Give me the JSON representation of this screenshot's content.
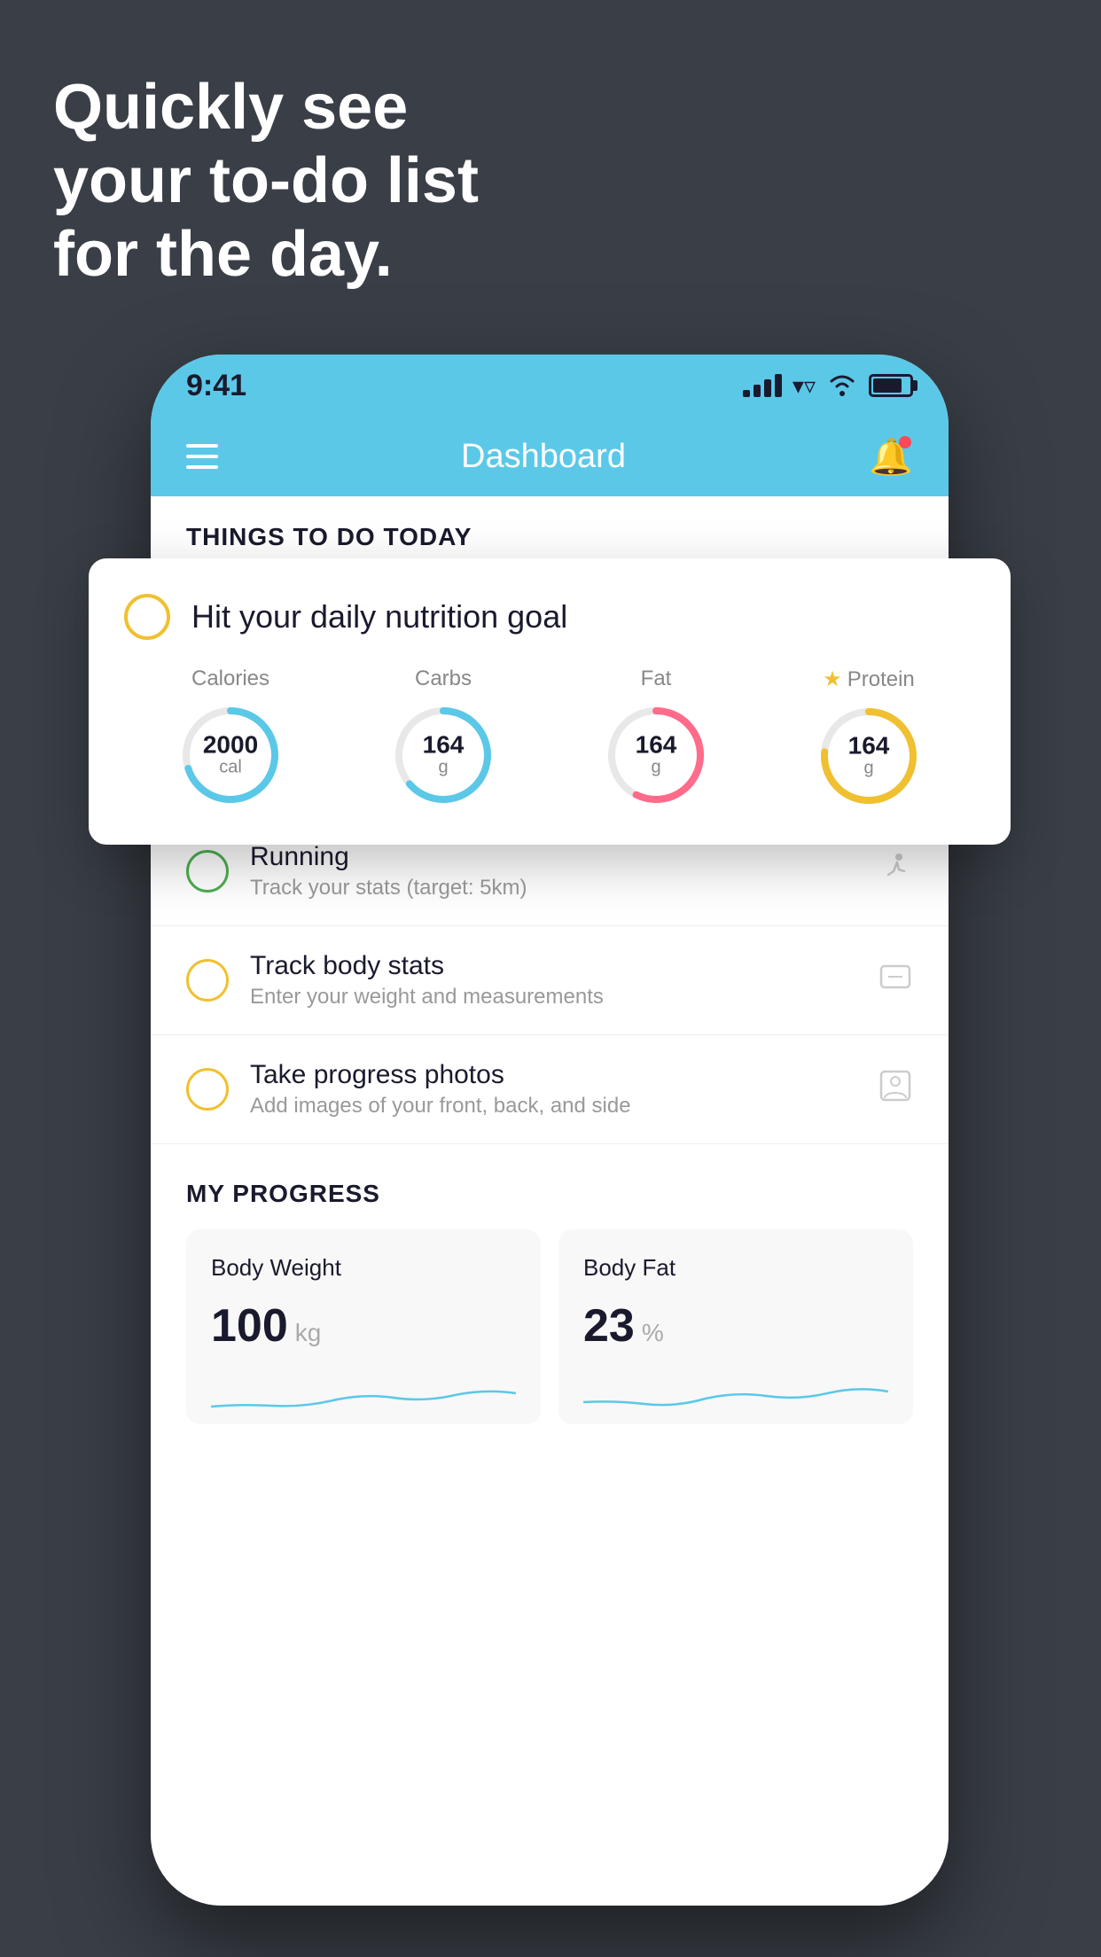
{
  "hero": {
    "line1": "Quickly see",
    "line2": "your to-do list",
    "line3": "for the day."
  },
  "status_bar": {
    "time": "9:41"
  },
  "header": {
    "title": "Dashboard"
  },
  "things_today": {
    "section_title": "THINGS TO DO TODAY"
  },
  "nutrition_card": {
    "title": "Hit your daily nutrition goal",
    "stats": [
      {
        "label": "Calories",
        "value": "2000",
        "unit": "cal",
        "color": "#5bc8e8",
        "starred": false
      },
      {
        "label": "Carbs",
        "value": "164",
        "unit": "g",
        "color": "#5bc8e8",
        "starred": false
      },
      {
        "label": "Fat",
        "value": "164",
        "unit": "g",
        "color": "#ff6b8a",
        "starred": false
      },
      {
        "label": "Protein",
        "value": "164",
        "unit": "g",
        "color": "#f0c030",
        "starred": true
      }
    ]
  },
  "todo_items": [
    {
      "title": "Running",
      "subtitle": "Track your stats (target: 5km)",
      "circle": "green",
      "icon": "👟"
    },
    {
      "title": "Track body stats",
      "subtitle": "Enter your weight and measurements",
      "circle": "yellow",
      "icon": "⚖️"
    },
    {
      "title": "Take progress photos",
      "subtitle": "Add images of your front, back, and side",
      "circle": "yellow",
      "icon": "👤"
    }
  ],
  "progress": {
    "section_title": "MY PROGRESS",
    "cards": [
      {
        "title": "Body Weight",
        "value": "100",
        "unit": "kg"
      },
      {
        "title": "Body Fat",
        "value": "23",
        "unit": "%"
      }
    ]
  }
}
